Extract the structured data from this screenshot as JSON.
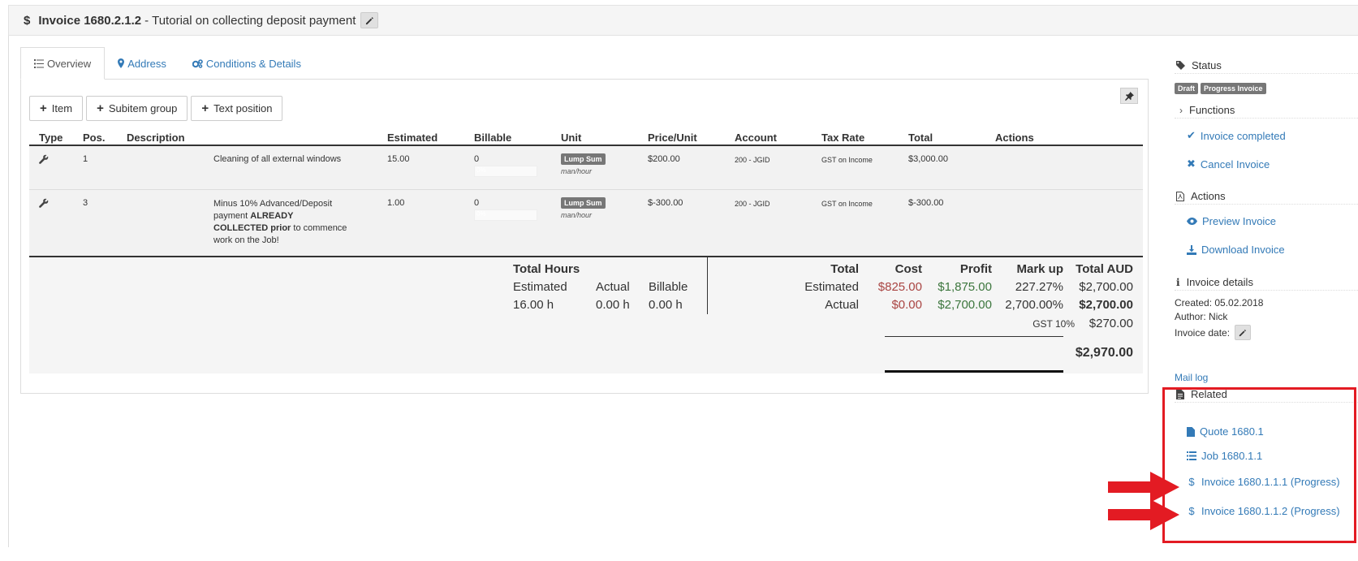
{
  "header": {
    "currency_icon": "$",
    "invoice_number": "Invoice 1680.2.1.2",
    "separator": "-",
    "invoice_title": "Tutorial on collecting deposit payment",
    "edit_icon": "pencil-icon"
  },
  "tabs": [
    {
      "label": "Overview",
      "icon": "list-icon"
    },
    {
      "label": "Address",
      "icon": "map-marker-icon"
    },
    {
      "label": "Conditions & Details",
      "icon": "gears-icon"
    }
  ],
  "toolbar": {
    "item_label": "Item",
    "subitem_label": "Subitem group",
    "text_label": "Text position"
  },
  "table": {
    "headers": {
      "type": "Type",
      "pos": "Pos.",
      "description": "Description",
      "estimated": "Estimated",
      "billable": "Billable",
      "unit": "Unit",
      "price_unit": "Price/Unit",
      "account": "Account",
      "tax_rate": "Tax Rate",
      "total": "Total",
      "actions": "Actions"
    },
    "rows": [
      {
        "pos": "1",
        "desc": "Cleaning of all external windows",
        "estimated": "15.00",
        "billable": "0",
        "billable_pct": "0%",
        "unit_badge": "Lump Sum",
        "unit_sub": "man/hour",
        "price": "$200.00",
        "account": "200 - JGID",
        "tax": "GST on Income",
        "total": "$3,000.00"
      },
      {
        "pos": "3",
        "desc_1": "Minus 10% Advanced/Deposit",
        "desc_2a": "payment ",
        "desc_2b": "ALREADY",
        "desc_3a": "COLLECTED prior",
        "desc_3b": " to commence",
        "desc_4": "work on the Job!",
        "estimated": "1.00",
        "billable": "0",
        "billable_pct": "0%",
        "unit_badge": "Lump Sum",
        "unit_sub": "man/hour",
        "price": "$-300.00",
        "account": "200 - JGID",
        "tax": "GST on Income",
        "total": "$-300.00"
      }
    ]
  },
  "totals": {
    "hours_title": "Total Hours",
    "estimated_label": "Estimated",
    "actual_label": "Actual",
    "billable_label": "Billable",
    "hours_estimated": "16.00 h",
    "hours_actual": "0.00 h",
    "hours_billable": "0.00 h",
    "col_total": "Total",
    "col_cost": "Cost",
    "col_profit": "Profit",
    "col_markup": "Mark up",
    "col_total_aud": "Total AUD",
    "est_row_label": "Estimated",
    "est_cost": "$825.00",
    "est_profit": "$1,875.00",
    "est_markup": "227.27%",
    "est_total": "$2,700.00",
    "act_row_label": "Actual",
    "act_cost": "$0.00",
    "act_profit": "$2,700.00",
    "act_markup": "2,700.00%",
    "act_total": "$2,700.00",
    "gst_label": "GST 10%",
    "gst_value": "$270.00",
    "grand_total": "$2,970.00"
  },
  "sidebar": {
    "status_title": "Status",
    "status_badges": [
      "Draft",
      "Progress Invoice"
    ],
    "functions_title": "Functions",
    "invoice_completed": "Invoice completed",
    "cancel_invoice": "Cancel Invoice",
    "actions_title": "Actions",
    "preview_invoice": "Preview Invoice",
    "download_invoice": "Download Invoice",
    "details_title": "Invoice details",
    "created": "Created: 05.02.2018",
    "author": "Author: Nick",
    "invoice_date": "Invoice date:",
    "mail_log": "Mail log",
    "related_title": "Related",
    "related": [
      {
        "label": "Quote 1680.1",
        "icon": "file-icon"
      },
      {
        "label": "Job 1680.1.1",
        "icon": "list-icon"
      },
      {
        "label": "Invoice 1680.1.1.1 (Progress)",
        "icon": "dollar-icon"
      },
      {
        "label": "Invoice 1680.1.1.2 (Progress)",
        "icon": "dollar-icon"
      }
    ]
  },
  "annotation": {
    "highlight_color": "#e31b23"
  }
}
